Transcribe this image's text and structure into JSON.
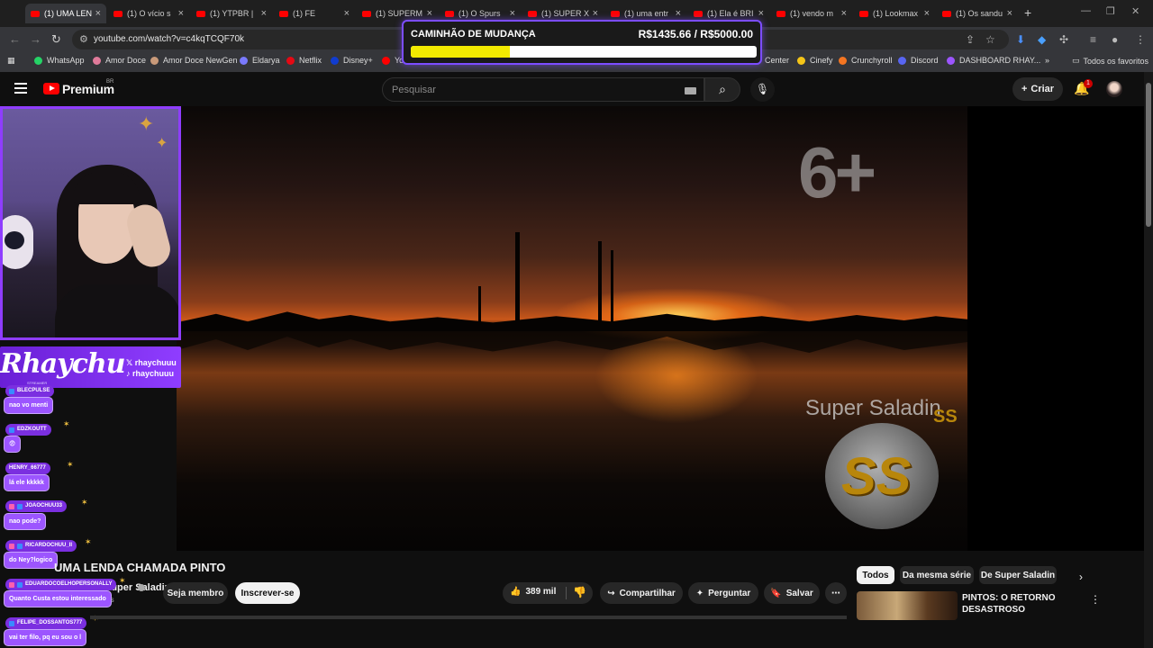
{
  "browser": {
    "tabs": [
      {
        "label": "(1) UMA LEN",
        "active": true
      },
      {
        "label": "(1) O vício s",
        "active": false
      },
      {
        "label": "(1) YTPBR |",
        "active": false
      },
      {
        "label": "(1) FE",
        "active": false
      },
      {
        "label": "(1) SUPERM",
        "active": false
      },
      {
        "label": "(1) O Spurs",
        "active": false
      },
      {
        "label": "(1) SUPER X",
        "active": false
      },
      {
        "label": "(1) uma entr",
        "active": false
      },
      {
        "label": "(1) Ela é BRI",
        "active": false
      },
      {
        "label": "(1) vendo m",
        "active": false
      },
      {
        "label": "(1) Lookmax",
        "active": false
      },
      {
        "label": "(1) Os sandu",
        "active": false
      }
    ],
    "url": "youtube.com/watch?v=c4kqTCQF70k",
    "bookmarks": [
      {
        "label": "WhatsApp",
        "color": "#25d366"
      },
      {
        "label": "Amor Doce",
        "color": "#e07a9a"
      },
      {
        "label": "Amor Doce NewGen",
        "color": "#c99a7a"
      },
      {
        "label": "Eldarya",
        "color": "#7a7aff"
      },
      {
        "label": "Netflix",
        "color": "#e50914"
      },
      {
        "label": "Disney+",
        "color": "#113ccf"
      },
      {
        "label": "Yo",
        "color": "#ff0000"
      },
      {
        "label": "Center",
        "color": ""
      },
      {
        "label": "Cinefy",
        "color": "#f5c518"
      },
      {
        "label": "Crunchyroll",
        "color": "#f47521"
      },
      {
        "label": "Discord",
        "color": "#5865f2"
      },
      {
        "label": "DASHBOARD RHAY...",
        "color": "#9c55ff"
      }
    ],
    "all_bookmarks": "Todos os favoritos"
  },
  "goal": {
    "title": "CAMINHÃO DE MUDANÇA",
    "amount": "R$1435.66 / R$5000.00",
    "progress": 0.287
  },
  "youtube": {
    "brand": "Premium",
    "region": "BR",
    "search_placeholder": "Pesquisar",
    "create_label": "Criar",
    "notification_count": "1"
  },
  "video": {
    "rating_overlay": "6+",
    "watermark": "Super Saladin",
    "logo_text": "SS",
    "title": "UMA LENDA CHAMADA PINTO",
    "channel": "Super Saladin",
    "subs_partial": "tos",
    "member_label": "Seja membro",
    "subscribe_label": "Inscrever-se",
    "likes": "389 mil",
    "share_label": "Compartilhar",
    "ask_label": "Perguntar",
    "save_label": "Salvar"
  },
  "streamer": {
    "name": "Rhaychu",
    "handle_x": "rhaychuuu",
    "handle_tiktok": "rhaychuuu",
    "tagline": "STREAMER"
  },
  "chat": [
    {
      "user": "BLECPULSE",
      "text": "nao vo menti"
    },
    {
      "user": "EDZKOUTT",
      "text": "😨"
    },
    {
      "user": "HENRY_66777",
      "text": "lá ele kkkkk"
    },
    {
      "user": "JOAOCHUU33",
      "text": "nao pode?"
    },
    {
      "user": "RICARDOCHUU_II",
      "text": "do Ney?logico"
    },
    {
      "user": "EDUARDOCOELHOPERSONALLY",
      "text": "Quanto Custa estou interessado"
    },
    {
      "user": "FELIPE_DOSSANTOS777",
      "text": "vai ter filo, pq eu sou o l"
    }
  ],
  "related": {
    "chips": [
      "Todos",
      "Da mesma série",
      "De Super Saladin"
    ],
    "first_title": "PINTOS: O RETORNO DESASTROSO"
  }
}
